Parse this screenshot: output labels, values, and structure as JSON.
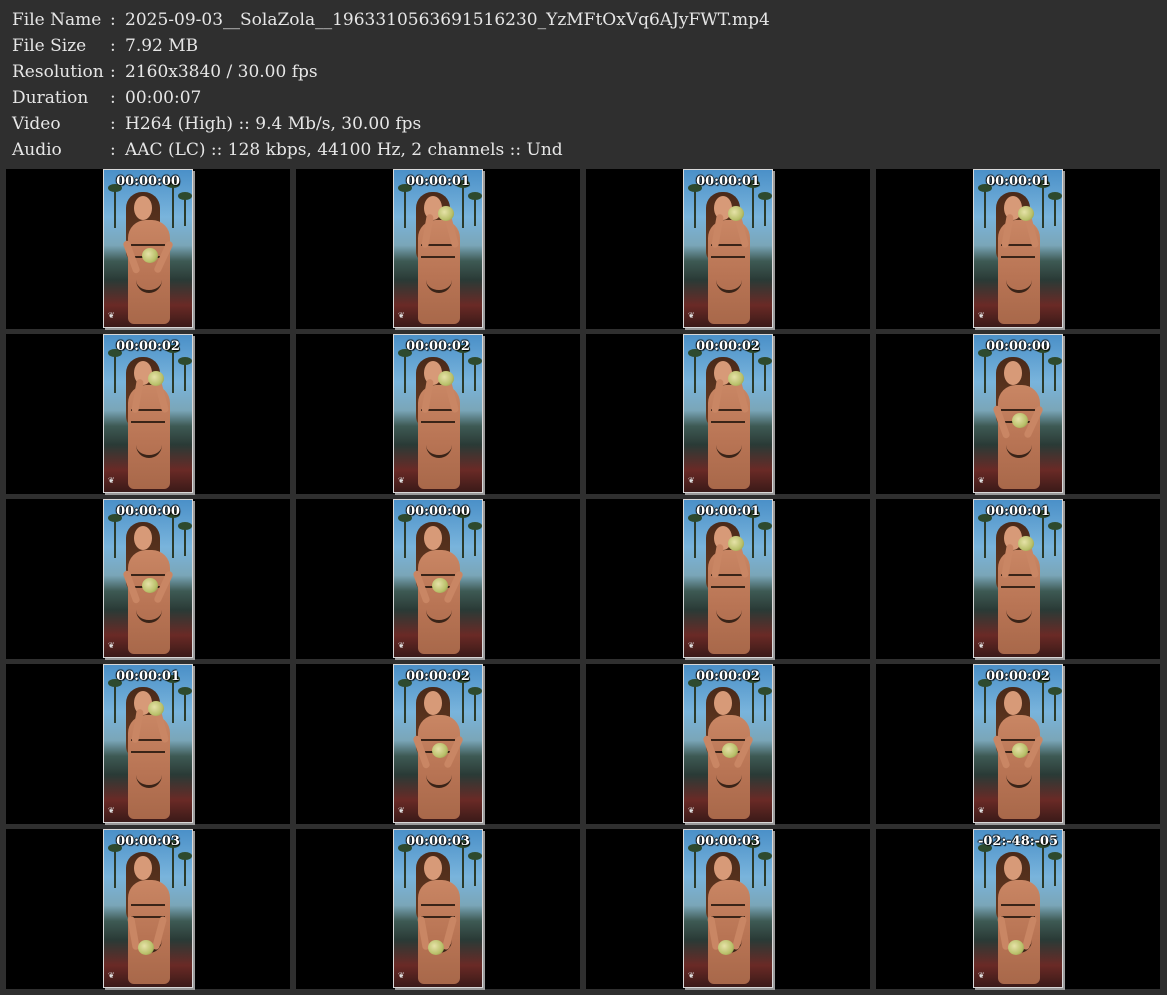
{
  "info": {
    "rows": [
      {
        "key": "File Name",
        "value": "2025-09-03__SolaZola__1963310563691516230_YzMFtOxVq6AJyFWT.mp4"
      },
      {
        "key": "File Size",
        "value": "7.92 MB"
      },
      {
        "key": "Resolution",
        "value": "2160x3840 / 30.00 fps"
      },
      {
        "key": "Duration",
        "value": "00:00:07"
      },
      {
        "key": "Video",
        "value": "H264 (High) :: 9.4 Mb/s, 30.00 fps"
      },
      {
        "key": "Audio",
        "value": "AAC (LC) :: 128 kbps, 44100 Hz, 2 channels :: Und"
      }
    ],
    "separator": ":"
  },
  "thumbnails": [
    {
      "timestamp": "00:00:00",
      "pose": "hold"
    },
    {
      "timestamp": "00:00:01",
      "pose": "drink"
    },
    {
      "timestamp": "00:00:01",
      "pose": "drink"
    },
    {
      "timestamp": "00:00:01",
      "pose": "drink"
    },
    {
      "timestamp": "00:00:02",
      "pose": "drink"
    },
    {
      "timestamp": "00:00:02",
      "pose": "drink"
    },
    {
      "timestamp": "00:00:02",
      "pose": "drink"
    },
    {
      "timestamp": "00:00:00",
      "pose": "hold"
    },
    {
      "timestamp": "00:00:00",
      "pose": "hold"
    },
    {
      "timestamp": "00:00:00",
      "pose": "hold"
    },
    {
      "timestamp": "00:00:01",
      "pose": "drink"
    },
    {
      "timestamp": "00:00:01",
      "pose": "drink"
    },
    {
      "timestamp": "00:00:01",
      "pose": "drink"
    },
    {
      "timestamp": "00:00:02",
      "pose": "hold"
    },
    {
      "timestamp": "00:00:02",
      "pose": "hold"
    },
    {
      "timestamp": "00:00:02",
      "pose": "hold"
    },
    {
      "timestamp": "00:00:03",
      "pose": "low"
    },
    {
      "timestamp": "00:00:03",
      "pose": "low"
    },
    {
      "timestamp": "00:00:03",
      "pose": "low"
    },
    {
      "timestamp": "-02:-48:-05",
      "pose": "low"
    }
  ],
  "colors": {
    "background": "#2f2f2f",
    "cell": "#000000",
    "text": "#e6e6e6",
    "timestamp": "#ffffff"
  }
}
